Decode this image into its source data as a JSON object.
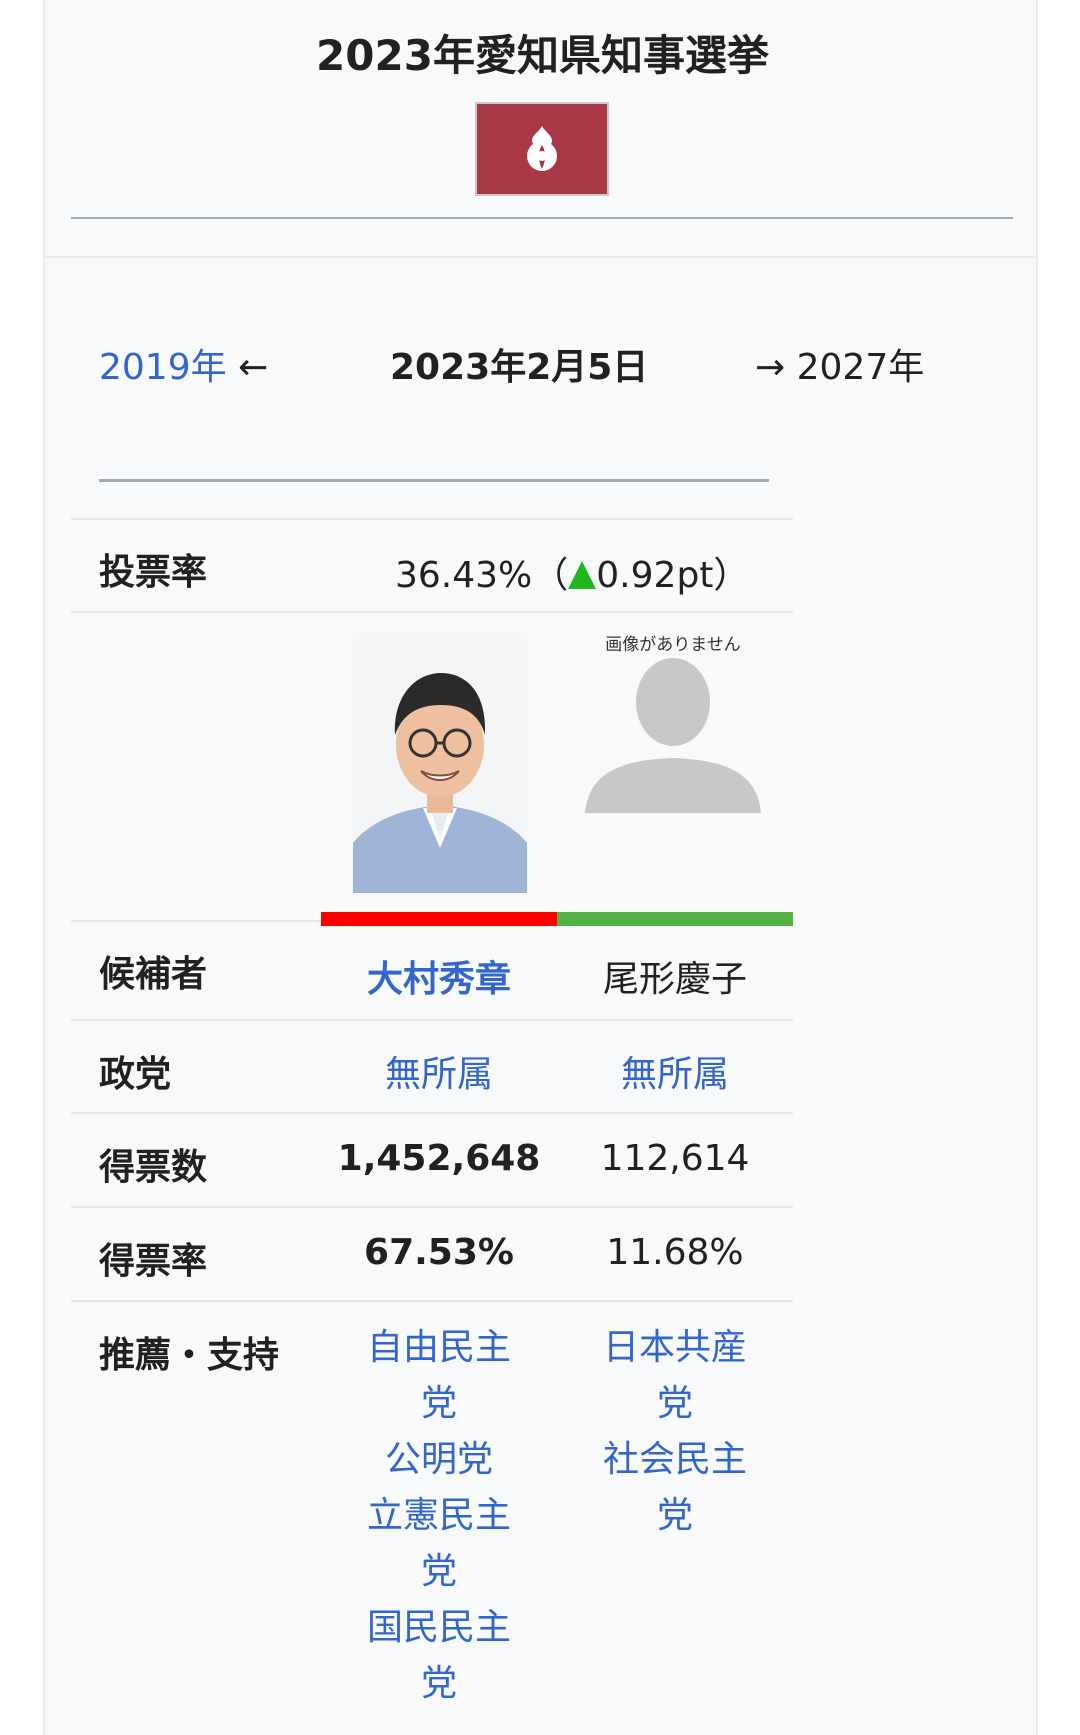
{
  "title": "2023年愛知県知事選挙",
  "flag": {
    "icon": "aichi-emblem-icon",
    "color": "#a83846"
  },
  "nav": {
    "prev": "2019年",
    "prev_arrow": "←",
    "date": "2023年2月5日",
    "next_arrow": "→",
    "next": "2027年"
  },
  "turnout": {
    "label": "投票率",
    "value": "36.43%（",
    "change": "0.92pt）",
    "trend_icon": "up-triangle-icon"
  },
  "photo": {
    "no_image_text": "画像がありません"
  },
  "colors": {
    "candidate1": "#ff0000",
    "candidate2": "#55b045",
    "link": "#3366cc"
  },
  "rows": {
    "candidate": {
      "label": "候補者",
      "c1": "大村秀章",
      "c2": "尾形慶子"
    },
    "party": {
      "label": "政党",
      "c1": "無所属",
      "c2": "無所属"
    },
    "votes": {
      "label": "得票数",
      "c1": "1,452,648",
      "c2": "112,614"
    },
    "rate": {
      "label": "得票率",
      "c1": "67.53%",
      "c2": "11.68%"
    },
    "endorse": {
      "label": "推薦・支持",
      "c1": [
        "自由民主党",
        "公明党",
        "立憲民主党",
        "国民民主党"
      ],
      "c2": [
        "日本共産党",
        "社会民主党"
      ]
    }
  }
}
